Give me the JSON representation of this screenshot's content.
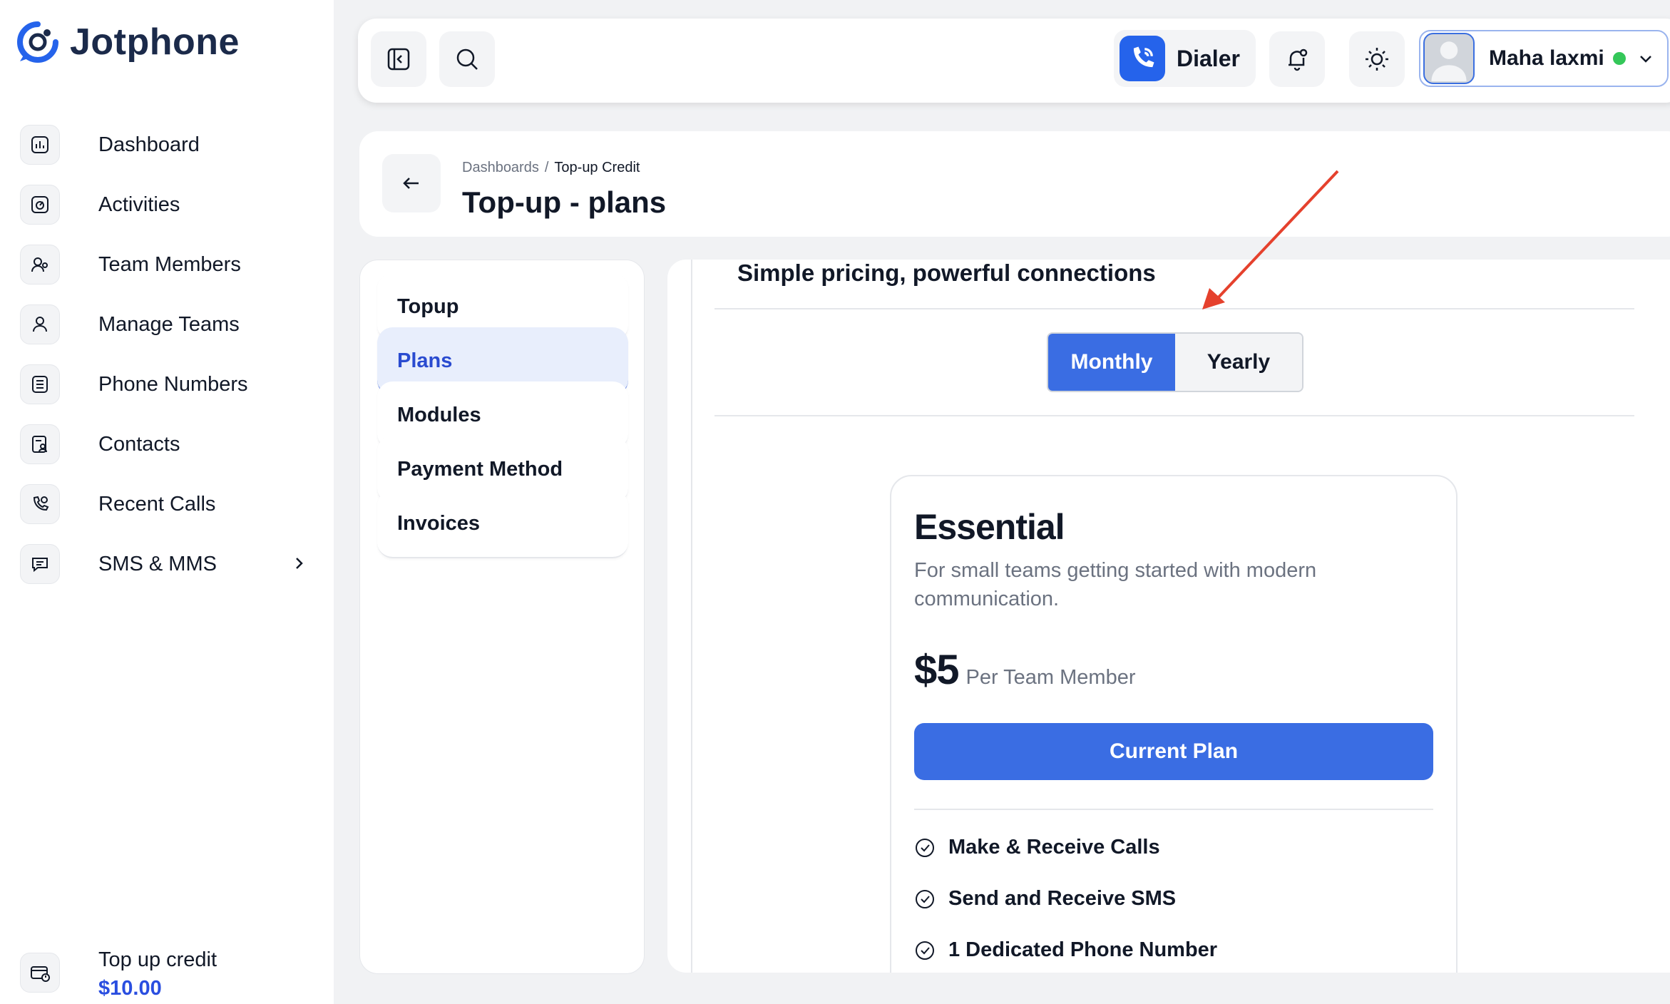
{
  "app": {
    "name": "Jotphone"
  },
  "sidebar": {
    "items": [
      {
        "label": "Dashboard",
        "icon": "bar-chart-icon"
      },
      {
        "label": "Activities",
        "icon": "activity-icon"
      },
      {
        "label": "Team Members",
        "icon": "team-members-icon"
      },
      {
        "label": "Manage Teams",
        "icon": "manage-teams-icon"
      },
      {
        "label": "Phone Numbers",
        "icon": "phone-numbers-icon"
      },
      {
        "label": "Contacts",
        "icon": "contacts-icon"
      },
      {
        "label": "Recent Calls",
        "icon": "recent-calls-icon"
      },
      {
        "label": "SMS & MMS",
        "icon": "message-icon"
      }
    ],
    "credit": {
      "label": "Top up credit",
      "value": "$10.00"
    }
  },
  "topbar": {
    "dialer_label": "Dialer",
    "user_name": "Maha laxmi",
    "status_color": "#34c759"
  },
  "header": {
    "breadcrumb": [
      "Dashboards",
      "Top-up Credit"
    ],
    "breadcrumb_sep": "/",
    "title": "Top-up - plans"
  },
  "menu": {
    "items": [
      "Topup",
      "Plans",
      "Modules",
      "Payment Method",
      "Invoices"
    ],
    "active": "Plans"
  },
  "content": {
    "tagline": "Simple pricing, powerful connections",
    "billing_toggle": {
      "options": [
        "Monthly",
        "Yearly"
      ],
      "selected": "Monthly"
    },
    "plan": {
      "name": "Essential",
      "description": "For small teams getting started with modern communication.",
      "price": "$5",
      "price_unit": "Per Team Member",
      "button_label": "Current Plan",
      "features": [
        "Make & Receive Calls",
        "Send and Receive SMS",
        "1 Dedicated Phone Number"
      ]
    }
  },
  "colors": {
    "accent": "#3a6de3",
    "brand": "#2563eb",
    "annotation": "#e5412d"
  }
}
